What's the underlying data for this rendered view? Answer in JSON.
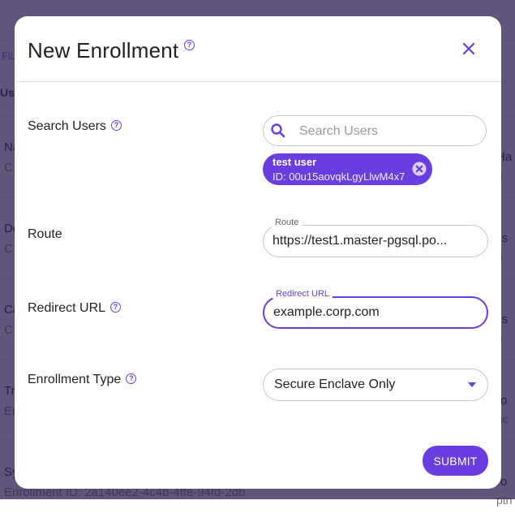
{
  "background": {
    "filter_label": "FIL",
    "column_header": "Us",
    "rows": [
      {
        "left_line1": "Na",
        "left_line2": "C",
        "right_line1": "Ha",
        "right_line2": "o"
      },
      {
        "left_line1": "De",
        "left_line2": "C",
        "right_line1": "lis",
        "right_line2": "o"
      },
      {
        "left_line1": "Ca",
        "left_line2": "C",
        "right_line1": "lis",
        "right_line2": "o"
      },
      {
        "left_line1": "Tr",
        "left_line2": "En",
        "right_line1": "ro",
        "right_line2": "nc"
      },
      {
        "left_line1": "Sy",
        "left_line2": "Enrollment ID: 2a140ee2-4c4b-4ffe-94fd-2db",
        "right_line1": "ro",
        "right_line2": "ptn"
      }
    ]
  },
  "modal": {
    "title": "New Enrollment",
    "help_glyph": "?",
    "close_label": "Close",
    "fields": {
      "search_users": {
        "label": "Search Users",
        "placeholder": "Search Users",
        "value": "",
        "selected_user": {
          "name": "test user",
          "id_text": "ID: 00u15aovqkLgyLlwM4x7"
        }
      },
      "route": {
        "label": "Route",
        "float_label": "Route",
        "value": "https://test1.master-pgsql.po..."
      },
      "redirect_url": {
        "label": "Redirect URL",
        "float_label": "Redirect URL",
        "value": "example.corp.com"
      },
      "enrollment_type": {
        "label": "Enrollment Type",
        "selected": "Secure Enclave Only"
      }
    },
    "submit_label": "SUBMIT"
  },
  "colors": {
    "accent": "#6a3de0",
    "overlay": "#5f5576"
  }
}
